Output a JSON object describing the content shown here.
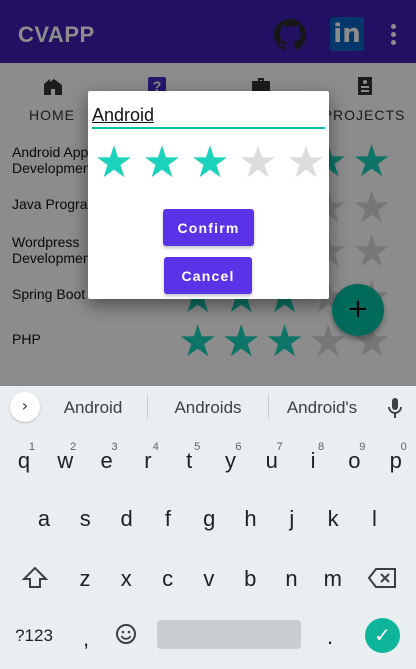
{
  "app": {
    "title": "CVAPP",
    "more_icon": "more-vert-icon",
    "github_icon": "github-icon",
    "linkedin_icon": "linkedin-icon",
    "linkedin_label": "in",
    "toolbar_color": "#3f1eb4"
  },
  "tabs": [
    {
      "label": "HOME",
      "icon": "home-icon"
    },
    {
      "label": "",
      "icon": "help-icon"
    },
    {
      "label": "",
      "icon": "briefcase-icon"
    },
    {
      "label": "PROJECTS",
      "icon": "document-icon"
    }
  ],
  "skills": [
    {
      "name_line1": "Android App",
      "name_line2": "Development",
      "rating": 5
    },
    {
      "name_line1": "Java Progra",
      "name_line2": "",
      "rating": 0
    },
    {
      "name_line1": "Wordpress",
      "name_line2": "Development",
      "rating": 0
    },
    {
      "name_line1": "Spring Boot",
      "name_line2": "",
      "rating": 3
    },
    {
      "name_line1": "PHP",
      "name_line2": "",
      "rating": 3
    }
  ],
  "fab": {
    "label": "+",
    "icon": "plus-icon",
    "color": "#00c4a7"
  },
  "dialog": {
    "input_value": "Android",
    "rating": 3,
    "max_rating": 5,
    "star_on_color": "#1bd3bc",
    "star_off_color": "#dcdcdc",
    "confirm_label": "Confirm",
    "cancel_label": "Cancel",
    "button_color": "#5a33e8"
  },
  "keyboard": {
    "suggestions": [
      "Android",
      "Androids",
      "Android's"
    ],
    "row1": [
      "q",
      "w",
      "e",
      "r",
      "t",
      "y",
      "u",
      "i",
      "o",
      "p"
    ],
    "row1_hints": [
      "1",
      "2",
      "3",
      "4",
      "5",
      "6",
      "7",
      "8",
      "9",
      "0"
    ],
    "row2": [
      "a",
      "s",
      "d",
      "f",
      "g",
      "h",
      "j",
      "k",
      "l"
    ],
    "row3": [
      "z",
      "x",
      "c",
      "v",
      "b",
      "n",
      "m"
    ],
    "symbols_label": "?123",
    "comma": ",",
    "period": ".",
    "shift_icon": "shift-icon",
    "backspace_icon": "backspace-icon",
    "emoji_icon": "emoji-icon",
    "enter_icon": "check-icon",
    "mic_icon": "mic-icon",
    "expand_icon": "chevron-right-icon",
    "enter_color": "#0fb59a"
  }
}
